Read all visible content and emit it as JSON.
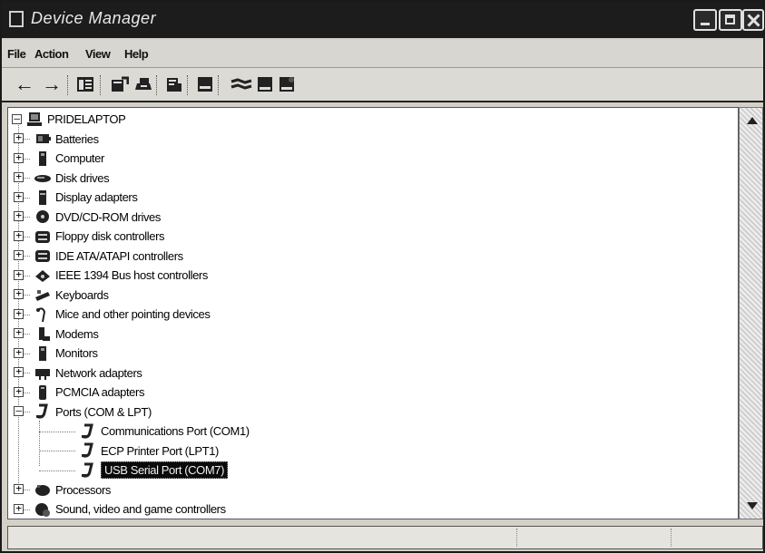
{
  "window": {
    "title": "Device Manager",
    "icon": "device-manager-icon"
  },
  "menubar": {
    "items": [
      {
        "label": "File",
        "icon": null
      },
      {
        "label": "Action",
        "icon": null
      },
      {
        "label": "View",
        "icon": null
      },
      {
        "label": "Help",
        "icon": null
      }
    ]
  },
  "toolbar": {
    "buttons": [
      "back-arrow",
      "forward-arrow",
      "show-hide-console-tree",
      "properties",
      "print",
      "help",
      "scan-hardware",
      "update-driver",
      "uninstall",
      "disable"
    ]
  },
  "tree": {
    "root": {
      "label": "PRIDELAPTOP",
      "icon": "computer-icon",
      "expanded": true
    },
    "categories": [
      {
        "label": "Batteries",
        "icon": "battery-icon",
        "expanded": false
      },
      {
        "label": "Computer",
        "icon": "computer-icon",
        "expanded": false
      },
      {
        "label": "Disk drives",
        "icon": "disk-drive-icon",
        "expanded": false
      },
      {
        "label": "Display adapters",
        "icon": "display-adapter-icon",
        "expanded": false
      },
      {
        "label": "DVD/CD-ROM drives",
        "icon": "dvd-drive-icon",
        "expanded": false
      },
      {
        "label": "Floppy disk controllers",
        "icon": "floppy-controller-icon",
        "expanded": false
      },
      {
        "label": "IDE ATA/ATAPI controllers",
        "icon": "ide-controller-icon",
        "expanded": false
      },
      {
        "label": "IEEE 1394 Bus host controllers",
        "icon": "ieee1394-icon",
        "expanded": false
      },
      {
        "label": "Keyboards",
        "icon": "keyboard-icon",
        "expanded": false
      },
      {
        "label": "Mice and other pointing devices",
        "icon": "mouse-icon",
        "expanded": false
      },
      {
        "label": "Modems",
        "icon": "modem-icon",
        "expanded": false
      },
      {
        "label": "Monitors",
        "icon": "monitor-icon",
        "expanded": false
      },
      {
        "label": "Network adapters",
        "icon": "network-adapter-icon",
        "expanded": false
      },
      {
        "label": "PCMCIA adapters",
        "icon": "pcmcia-icon",
        "expanded": false
      },
      {
        "label": "Ports (COM & LPT)",
        "icon": "port-icon",
        "expanded": true
      },
      {
        "label": "Processors",
        "icon": "processor-icon",
        "expanded": false
      },
      {
        "label": "Sound, video and game controllers",
        "icon": "sound-icon",
        "expanded": false
      }
    ],
    "ports_children": [
      {
        "label": "Communications Port (COM1)",
        "icon": "port-icon",
        "selected": false
      },
      {
        "label": "ECP Printer Port (LPT1)",
        "icon": "port-icon",
        "selected": false
      },
      {
        "label": "USB Serial Port (COM7)",
        "icon": "port-icon",
        "selected": true
      }
    ]
  },
  "colors": {
    "titlebar": "#1c1c1c",
    "selection": "#0a0a0a",
    "window": "#d4d0c8"
  }
}
